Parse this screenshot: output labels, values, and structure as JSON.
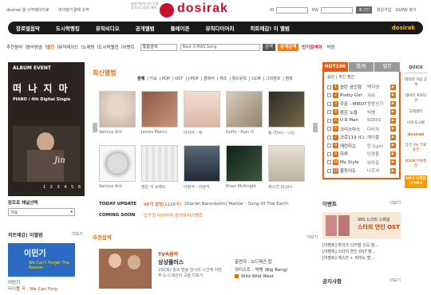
{
  "top": {
    "links": [
      "dosirak 을 시작페이지로",
      "마이정기결제 고객"
    ],
    "banner_text": "회원가입하시면 무료음악과 다양한 혜택",
    "logo": "dosirak",
    "id_label": "ID",
    "pw_label": "PW",
    "login_button": "로그인",
    "join": "회원가입",
    "find": "ID/PW 찾기"
  },
  "nav": {
    "items": [
      "장르별음악",
      "도시락랭킹",
      "뮤직비디오",
      "공개앨범",
      "플레이존",
      "뮤직다이어리",
      "히트예감! 이 앨범"
    ],
    "logo": "dosirak"
  },
  "subnav": {
    "items": [
      "추천음악",
      "음악방송",
      "벨진",
      "뮤직테이드",
      "노래방",
      "도시락웹진",
      "이벤트"
    ],
    "hot_item": "벨진",
    "select_value": "통합검색",
    "search_value": "Best X-MAS Song",
    "search_button": "검색",
    "detail_button": "상세검색",
    "rank_label": "인기검색어",
    "rank_item": "박봄"
  },
  "left": {
    "album_event": {
      "title": "ALBUM EVENT",
      "hangul": "떠 나 지 마",
      "subtitle": "PIANO / 4th Digital Single",
      "signature": "Jin",
      "pager": "1 2 3 4 5 6"
    },
    "genre": {
      "title": "장르로 채널선택",
      "select": "가요"
    },
    "hot_video": {
      "title": "히트예감! 이앨범",
      "more": "더보기",
      "thumb_title": "이민기",
      "thumb_sub": "We Can't Forget The Reason",
      "caption": "이민기",
      "caption2": "타이틀 곡 : We Can Forg"
    }
  },
  "center": {
    "title_a": "최신",
    "title_b": "앨범",
    "tabs": [
      "전체",
      "가요",
      "POP",
      "OST",
      "J-POP",
      "클래식",
      "재즈",
      "월드뮤직",
      "CCM",
      "그외장르",
      "범죄"
    ],
    "row1": [
      "Various Arti",
      "James Morris",
      "이지아 - 애",
      "Duffy - Rain O",
      "팀 (Tim) - 니는"
    ],
    "row2": [
      "Various Arti",
      "명은 이 브래드",
      "이정석 - 이정석",
      "Brian McKnight",
      "에스잔 (S.Jin)"
    ],
    "updates": {
      "today_label": "TODAY UPDATE",
      "today_count": "98개 앨범(1126곡)",
      "today_text": "[Daniel Barenboim] Mahler : Song Of The Earth",
      "soon_label": "COMING SOON",
      "soon_text": "압구정 다이어리 감성뮤비이벤트"
    },
    "rec": {
      "title": "추천음악",
      "more": "더보기",
      "tv": "TV속음악",
      "show": "상상플러스",
      "desc": "2日(화) 월요 방송 당시의 시간에 이번 주 G-드래곤의 곡을 더보기",
      "r1": "출연자 : G드래곤,탑",
      "r2": "아티스트 : 빅뱅 (Big Bang)",
      "r3": "Wild Wild West"
    }
  },
  "right": {
    "tabs": [
      "HOT100",
      "벨/링",
      "벨뮤"
    ],
    "sub": "음원 | 주간 벨진",
    "chart": [
      {
        "n": "1",
        "song": "송탄 곰인형",
        "artist": "백지영"
      },
      {
        "n": "2",
        "song": "Pretty Girl",
        "artist": "카라"
      },
      {
        "n": "3",
        "song": "주문 - MIROTIC",
        "artist": "동방신기"
      },
      {
        "n": "4",
        "song": "붉은 노을",
        "artist": "빅뱅"
      },
      {
        "n": "5",
        "song": "U R Man",
        "artist": "SS501"
      },
      {
        "n": "6",
        "song": "크리스마스",
        "artist": "다비치"
      },
      {
        "n": "7",
        "song": "크로119 (Ci...)",
        "artist": "케이블"
      },
      {
        "n": "8",
        "song": "애련하는",
        "artist": "린 (Lyn)"
      },
      {
        "n": "9",
        "song": "하루",
        "artist": "민경훈"
      },
      {
        "n": "10",
        "song": "My Style",
        "artist": "브라운"
      },
      {
        "n": "11",
        "song": "불장이도",
        "artist": "나르샤"
      }
    ],
    "event": {
      "title": "이벤트",
      "more": "더보기",
      "banner_l1": "SBS 드라마 스페셜",
      "banner_l2": "스타의 연인 OST",
      "list": [
        "[이벤트] 마이크 디지털 신곡 발...",
        "[이벤트] 스타의 연인 OST 발...",
        "[이벤트] 에스잔 + 피아노 발..."
      ]
    },
    "notice": {
      "title": "공지사항",
      "more": "더보기"
    }
  },
  "quick": {
    "title": "QUICK",
    "items": [
      "데이터 가입 고객",
      "데이터 프로모션",
      "고객센터",
      "나의 도시락"
    ],
    "logo": "dosirak",
    "kb": "동전 3% 무료충전",
    "kb2": "KOOK 무료충전",
    "mp3": "MP3 구매안내 MP3"
  }
}
